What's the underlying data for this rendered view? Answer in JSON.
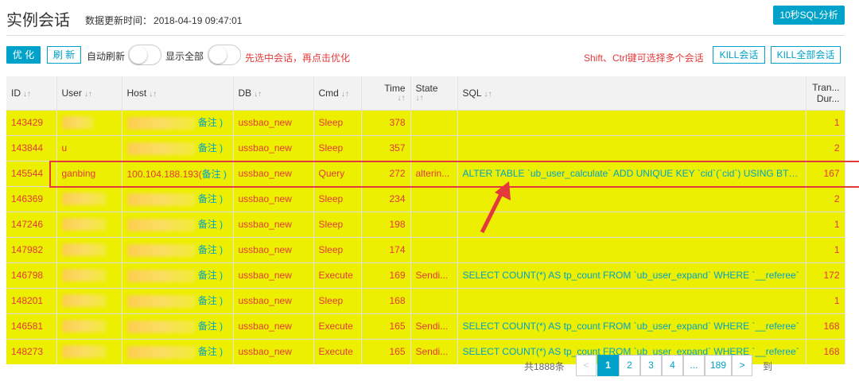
{
  "header": {
    "title": "实例会话",
    "update_label": "数据更新时间：",
    "update_time": "2018-04-19 09:47:01",
    "sql_analyze_button": "10秒SQL分析"
  },
  "toolbar": {
    "optimize_button": "优 化",
    "refresh_button": "刷 新",
    "auto_refresh_label": "自动刷新",
    "show_all_label": "显示全部",
    "select_hint": "先选中会话，再点击优化",
    "multi_select_hint": "Shift、Ctrl键可选择多个会话",
    "kill_button": "KILL会话",
    "kill_all_button": "KILL全部会话"
  },
  "table": {
    "columns": {
      "id": "ID",
      "user": "User",
      "host": "Host",
      "db": "DB",
      "cmd": "Cmd",
      "time": "Time",
      "state": "State",
      "sql": "SQL",
      "trx_line1": "Tran...",
      "trx_line2": "Dur..."
    },
    "sort_icon": "↓↑",
    "rows": [
      {
        "id": "143429",
        "user": "",
        "host_note": "备注 )",
        "db": "ussbao_new",
        "cmd": "Sleep",
        "time": "378",
        "state": "",
        "sql": "",
        "trx": "1"
      },
      {
        "id": "143844",
        "user": "u",
        "host_note": "备注 )",
        "db": "ussbao_new",
        "cmd": "Sleep",
        "time": "357",
        "state": "",
        "sql": "",
        "trx": "2"
      },
      {
        "id": "145544",
        "user": "ganbing",
        "host": "100.104.188.193(",
        "host_note": "备注 )",
        "db": "ussbao_new",
        "cmd": "Query",
        "time": "272",
        "state": "alterin...",
        "sql": "ALTER TABLE `ub_user_calculate` ADD UNIQUE KEY `cid`(`cid`) USING BTREE",
        "trx": "167"
      },
      {
        "id": "146369",
        "user": "",
        "host_note": "备注 )",
        "db": "ussbao_new",
        "cmd": "Sleep",
        "time": "234",
        "state": "",
        "sql": "",
        "trx": "2"
      },
      {
        "id": "147246",
        "user": "",
        "host_note": "备注 )",
        "db": "ussbao_new",
        "cmd": "Sleep",
        "time": "198",
        "state": "",
        "sql": "",
        "trx": "1"
      },
      {
        "id": "147982",
        "user": "",
        "host_note": "备注 )",
        "db": "ussbao_new",
        "cmd": "Sleep",
        "time": "174",
        "state": "",
        "sql": "",
        "trx": "1"
      },
      {
        "id": "146798",
        "user": "",
        "host_note": "备注 )",
        "db": "ussbao_new",
        "cmd": "Execute",
        "time": "169",
        "state": "Sendi...",
        "sql": "SELECT COUNT(*) AS tp_count FROM `ub_user_expand` WHERE `__referee`",
        "trx": "172"
      },
      {
        "id": "148201",
        "user": "",
        "host_note": "备注 )",
        "db": "ussbao_new",
        "cmd": "Sleep",
        "time": "168",
        "state": "",
        "sql": "",
        "trx": "1"
      },
      {
        "id": "146581",
        "user": "",
        "host_note": "备注 )",
        "db": "ussbao_new",
        "cmd": "Execute",
        "time": "165",
        "state": "Sendi...",
        "sql": "SELECT COUNT(*) AS tp_count FROM `ub_user_expand` WHERE `__referee`",
        "trx": "168"
      },
      {
        "id": "148273",
        "user": "",
        "host_note": "备注 )",
        "db": "ussbao_new",
        "cmd": "Execute",
        "time": "165",
        "state": "Sendi...",
        "sql": "SELECT COUNT(*) AS tp_count FROM `ub_user_expand` WHERE `__referee`",
        "trx": "168"
      }
    ]
  },
  "pagination": {
    "total": "共1888条",
    "prev": "<",
    "pages": [
      "1",
      "2",
      "3",
      "4",
      "...",
      "189"
    ],
    "next": ">",
    "goto": "到"
  },
  "colors": {
    "accent": "#00a2ca",
    "row_highlight": "#ecef00",
    "alert_red": "#e4393c"
  }
}
